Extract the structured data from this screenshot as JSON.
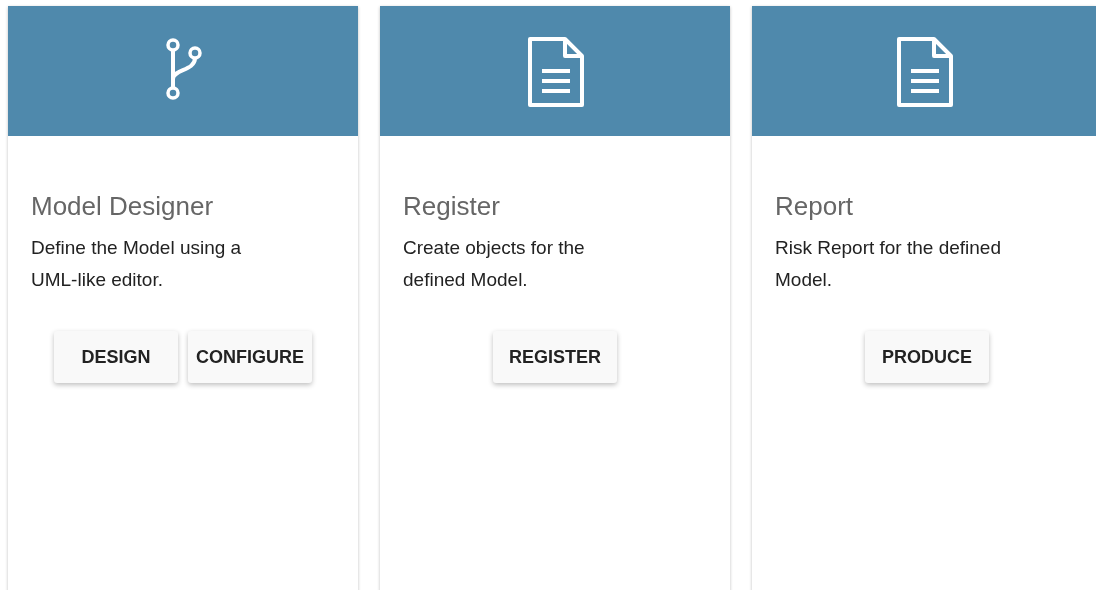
{
  "cards": [
    {
      "kind": "branch",
      "title": "Model Designer",
      "description": "Define the Model using a UML-like editor.",
      "buttons": [
        "DESIGN",
        "CONFIGURE"
      ]
    },
    {
      "kind": "document",
      "title": "Register",
      "description": "Create objects for the defined Model.",
      "buttons": [
        "REGISTER"
      ]
    },
    {
      "kind": "document",
      "title": "Report",
      "description": "Risk Report for the defined Model.",
      "buttons": [
        "PRODUCE"
      ]
    }
  ]
}
